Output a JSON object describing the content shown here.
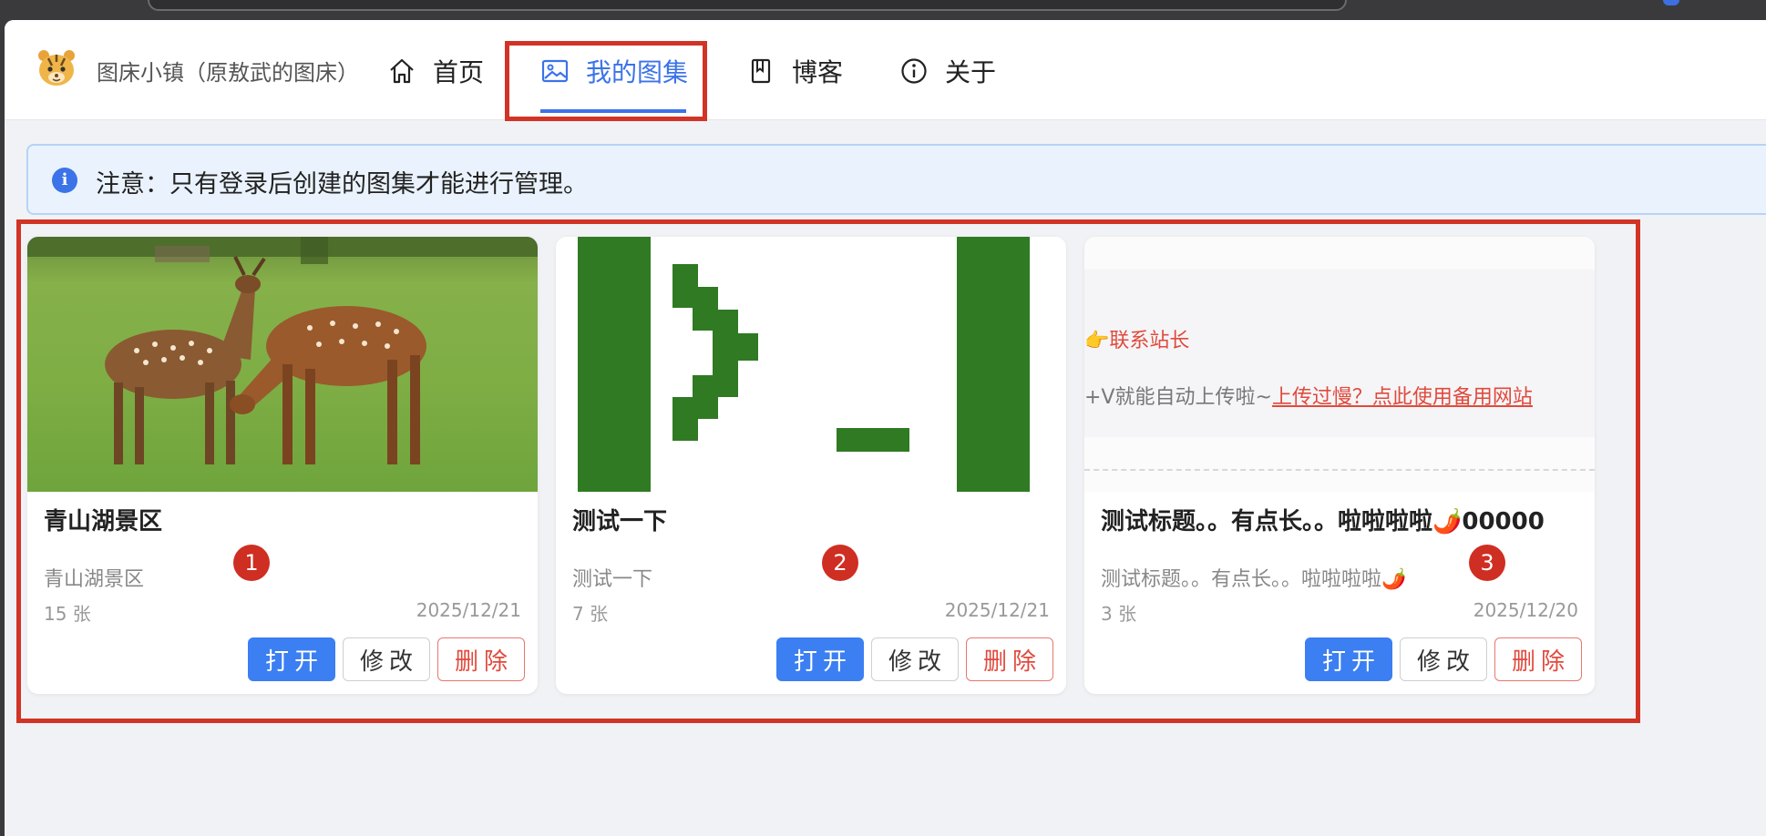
{
  "nav": {
    "site_title": "图床小镇（原敖武的图床）",
    "items": [
      {
        "label": "首页",
        "icon": "home-icon"
      },
      {
        "label": "我的图集",
        "icon": "image-icon"
      },
      {
        "label": "博客",
        "icon": "book-icon"
      },
      {
        "label": "关于",
        "icon": "info-icon"
      }
    ],
    "active_index": 1
  },
  "alert": {
    "icon": "info-icon",
    "text": "注意：只有登录后创建的图集才能进行管理。"
  },
  "cards": [
    {
      "title": "青山湖景区",
      "description": "青山湖景区",
      "count": "15 张",
      "date": "2025/12/21",
      "badge": "1",
      "thumbnail": "deer-photo"
    },
    {
      "title": "测试一下",
      "description": "测试一下",
      "count": "7 张",
      "date": "2025/12/21",
      "badge": "2",
      "thumbnail": "terminal-logo"
    },
    {
      "title": "测试标题。。有点长。。啦啦啦啦🌶️00000",
      "description": "测试标题。。有点长。。啦啦啦啦🌶️",
      "count": "3 张",
      "date": "2025/12/20",
      "badge": "3",
      "thumbnail": "page-screenshot",
      "thumb_text_1": "👉联系站长",
      "thumb_text_2a": "+V就能自动上传啦~",
      "thumb_text_2b": "上传过慢？点此使用备用网站"
    }
  ],
  "buttons": {
    "open": "打开",
    "edit": "修改",
    "delete": "删除"
  },
  "colors": {
    "accent": "#3b73e8",
    "danger": "#e04a3d",
    "annotation": "#d13426"
  }
}
